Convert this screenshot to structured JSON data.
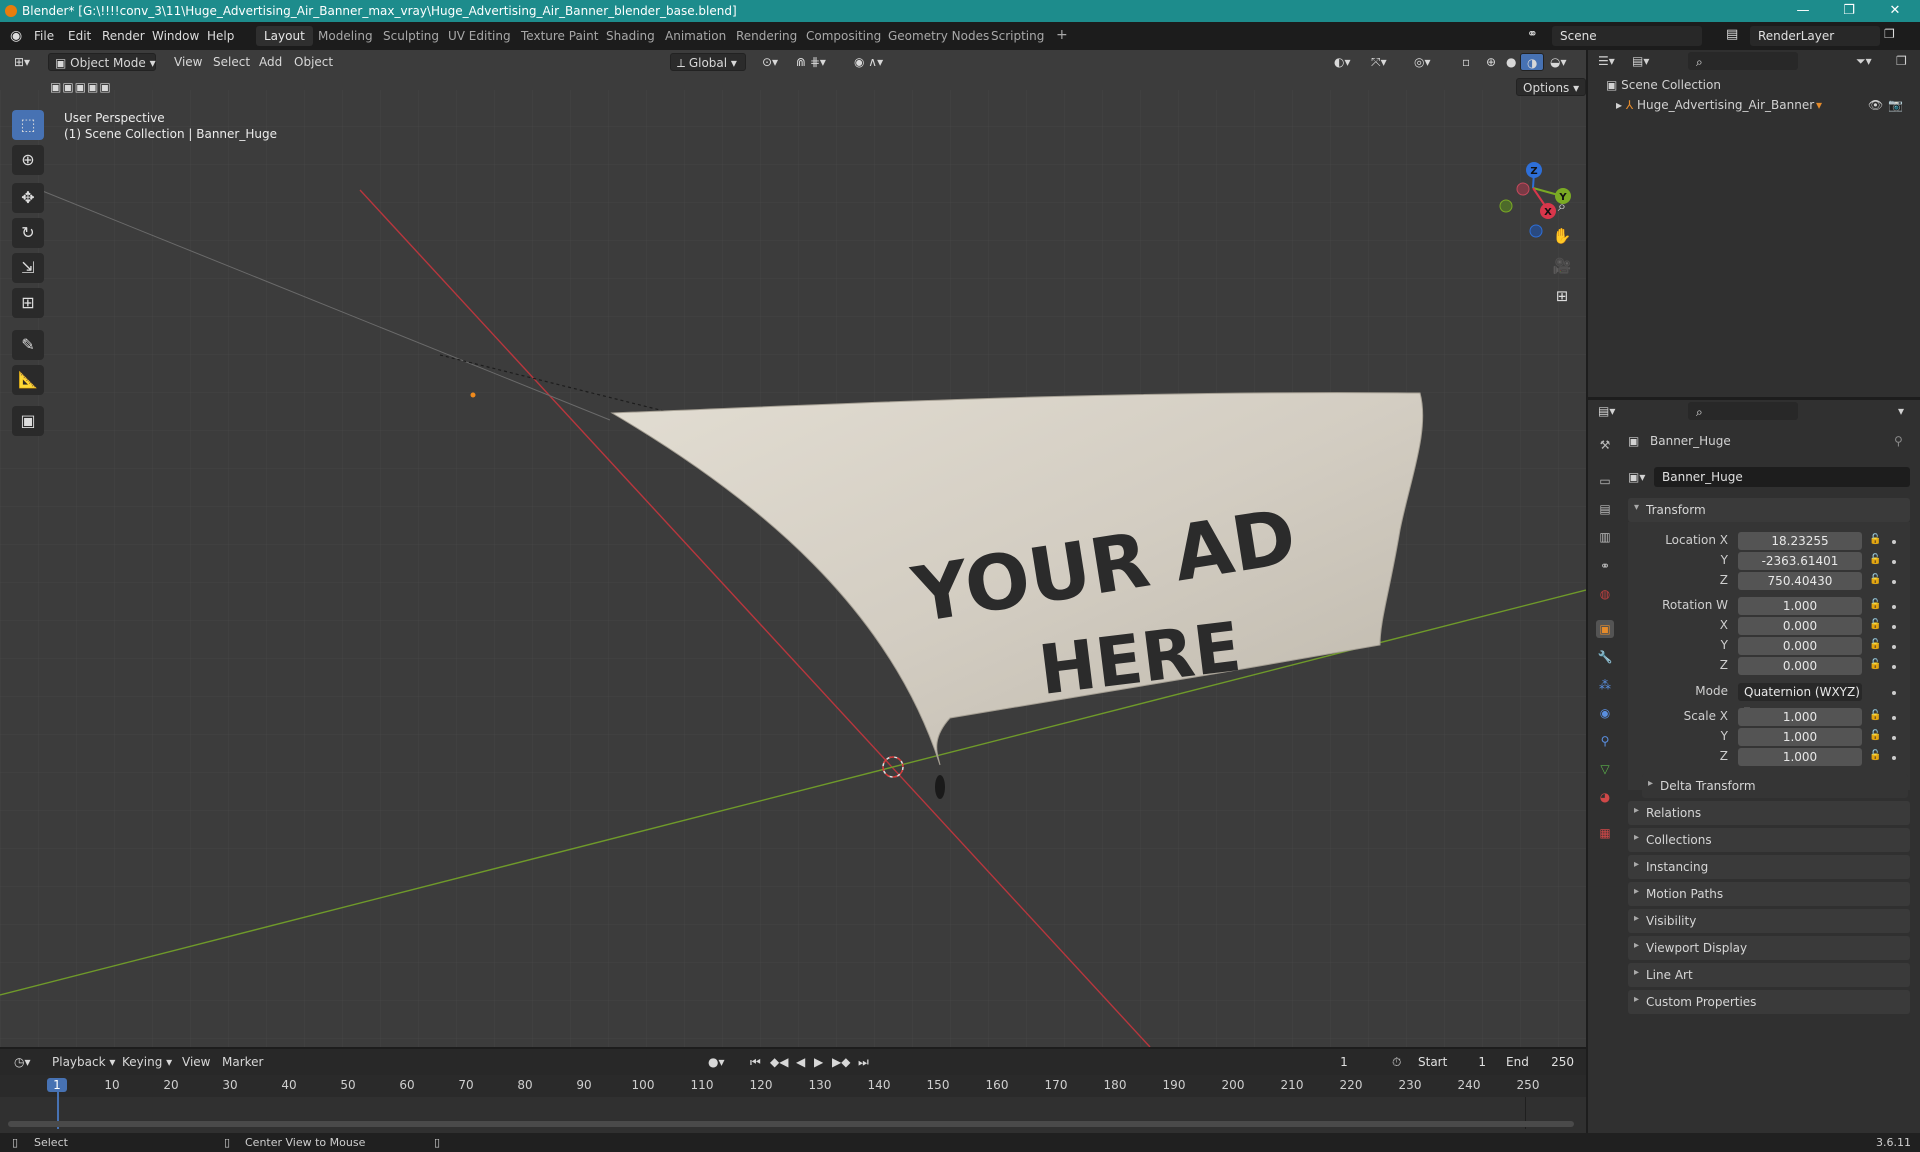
{
  "titlebar": {
    "title": "Blender* [G:\\!!!!conv_3\\11\\Huge_Advertising_Air_Banner_max_vray\\Huge_Advertising_Air_Banner_blender_base.blend]",
    "minimize": "—",
    "maximize": "❐",
    "close": "✕"
  },
  "menu": {
    "file": "File",
    "edit": "Edit",
    "render": "Render",
    "window": "Window",
    "help": "Help"
  },
  "workspaces": [
    "Layout",
    "Modeling",
    "Sculpting",
    "UV Editing",
    "Texture Paint",
    "Shading",
    "Animation",
    "Rendering",
    "Compositing",
    "Geometry Nodes",
    "Scripting"
  ],
  "workspace_add": "+",
  "scene": {
    "name": "Scene",
    "render_layer": "RenderLayer"
  },
  "viewport": {
    "mode": "Object Mode",
    "menus": {
      "view": "View",
      "select": "Select",
      "add": "Add",
      "object": "Object"
    },
    "orientation": "Global",
    "options": "Options",
    "perspective": "User Perspective",
    "collection_line": "(1) Scene Collection | Banner_Huge",
    "banner_text_line1": "YOUR AD",
    "banner_text_line2": "HERE",
    "gizmo": {
      "z": "Z",
      "y": "Y",
      "x": "X"
    }
  },
  "outliner": {
    "root": "Scene Collection",
    "item": "Huge_Advertising_Air_Banner"
  },
  "properties": {
    "object_name": "Banner_Huge",
    "datablock_name": "Banner_Huge",
    "transform": {
      "header": "Transform",
      "location_label": "Location X",
      "y_label": "Y",
      "z_label": "Z",
      "x_label": "X",
      "location": [
        "18.23255",
        "-2363.61401",
        "750.40430"
      ],
      "rotation_label": "Rotation W",
      "rotation": [
        "1.000",
        "0.000",
        "0.000",
        "0.000"
      ],
      "mode_label": "Mode",
      "mode_value": "Quaternion (WXYZ)",
      "scale_label": "Scale X",
      "scale": [
        "1.000",
        "1.000",
        "1.000"
      ],
      "delta": "Delta Transform"
    },
    "panels": [
      "Relations",
      "Collections",
      "Instancing",
      "Motion Paths",
      "Visibility",
      "Viewport Display",
      "Line Art",
      "Custom Properties"
    ]
  },
  "timeline": {
    "menus": {
      "playback": "Playback",
      "keying": "Keying",
      "view": "View",
      "marker": "Marker"
    },
    "current_frame": "1",
    "start_label": "Start",
    "start": "1",
    "end_label": "End",
    "end": "250",
    "ruler": [
      "1",
      "10",
      "20",
      "30",
      "40",
      "50",
      "60",
      "70",
      "80",
      "90",
      "100",
      "110",
      "120",
      "130",
      "140",
      "150",
      "160",
      "170",
      "180",
      "190",
      "200",
      "210",
      "220",
      "230",
      "240",
      "250"
    ]
  },
  "status": {
    "select": "Select",
    "center": "Center View to Mouse",
    "version": "3.6.11"
  }
}
